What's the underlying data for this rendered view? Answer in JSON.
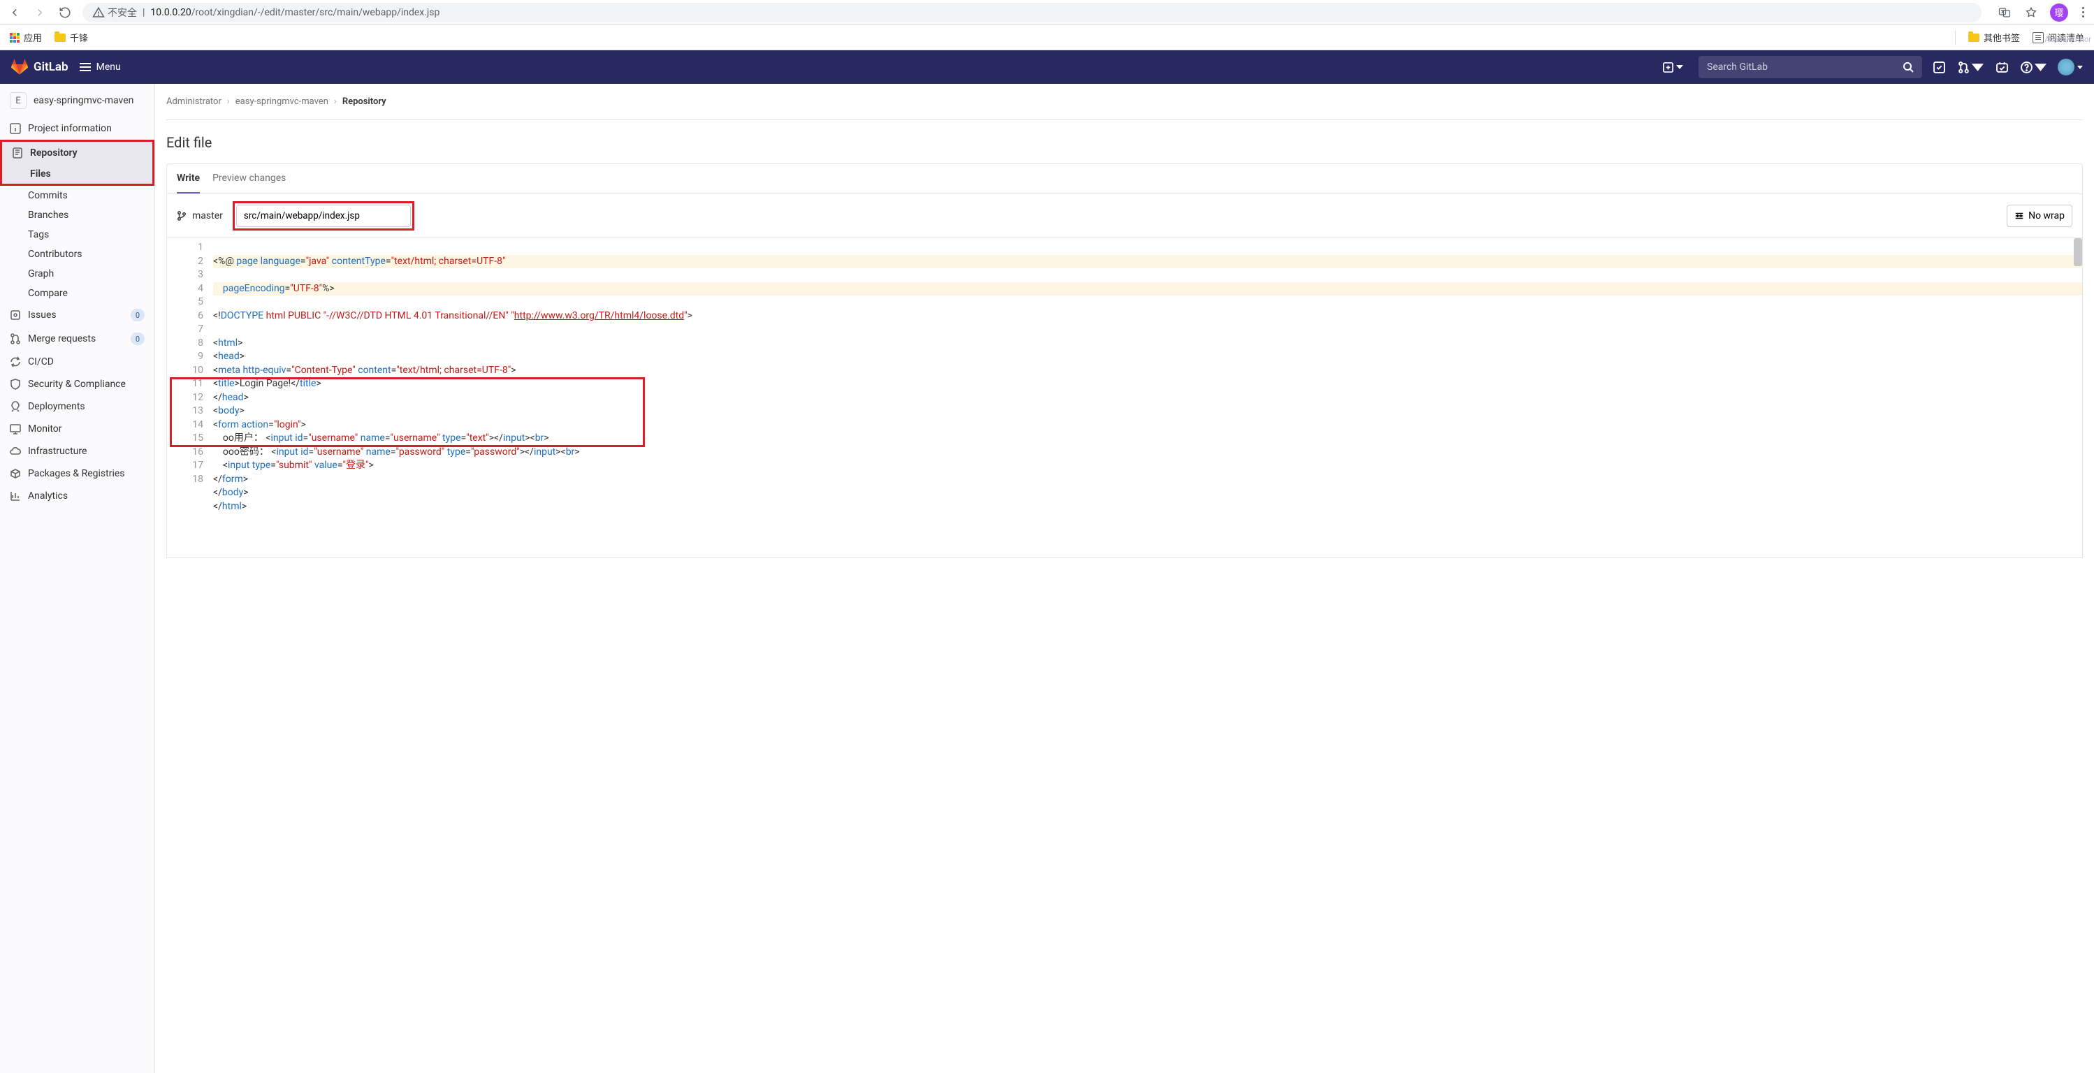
{
  "browser": {
    "insecure_label": "不安全",
    "url_host": "10.0.0.20",
    "url_path": "/root/xingdian/-/edit/master/src/main/webapp/index.jsp",
    "profile_letter": "璎"
  },
  "bookmarks_bar": {
    "apps": "应用",
    "folder1": "千锋",
    "other_bookmarks": "其他书签",
    "reading_list": "阅读清单"
  },
  "gitlab_header": {
    "brand": "GitLab",
    "menu": "Menu",
    "search_placeholder": "Search GitLab",
    "user_label": "Administrator"
  },
  "sidebar": {
    "project_letter": "E",
    "project_name": "easy-springmvc-maven",
    "items": {
      "project_info": "Project information",
      "repository": "Repository",
      "files": "Files",
      "commits": "Commits",
      "branches": "Branches",
      "tags": "Tags",
      "contributors": "Contributors",
      "graph": "Graph",
      "compare": "Compare",
      "issues": "Issues",
      "issues_badge": "0",
      "merge_requests": "Merge requests",
      "mr_badge": "0",
      "cicd": "CI/CD",
      "security": "Security & Compliance",
      "deployments": "Deployments",
      "monitor": "Monitor",
      "infrastructure": "Infrastructure",
      "packages": "Packages & Registries",
      "analytics": "Analytics"
    }
  },
  "breadcrumb": {
    "admin": "Administrator",
    "project": "easy-springmvc-maven",
    "repo": "Repository"
  },
  "editor": {
    "page_title": "Edit file",
    "tab_write": "Write",
    "tab_preview": "Preview changes",
    "branch": "master",
    "file_path": "src/main/webapp/index.jsp",
    "nowrap_label": "No wrap"
  },
  "code": {
    "doctype_url": "http://www.w3.org/TR/html4/loose.dtd",
    "title_text": "Login Page!",
    "user_label": "oo用户：",
    "pwd_label": "ooo密码：",
    "submit_value": "登录"
  }
}
